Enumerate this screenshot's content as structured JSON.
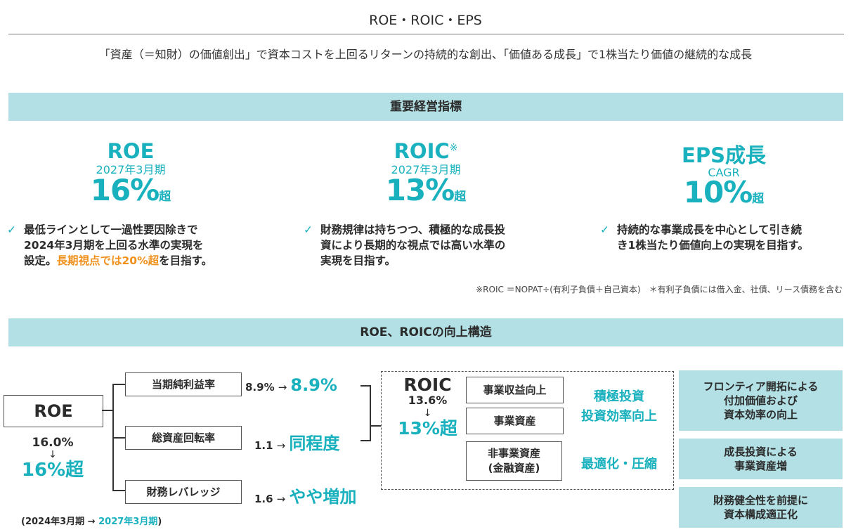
{
  "header": {
    "title": "ROE・ROIC・EPS",
    "subtitle": "「資産（＝知財）の価値創出」で資本コストを上回るリターンの持続的な創出、「価値ある成長」で1株当たり価値の継続的な成長"
  },
  "kpi_section": {
    "title": "重要経営指標",
    "items": [
      {
        "name": "ROE",
        "period": "2027年3月期",
        "value": "16%",
        "suffix": "超",
        "desc_lines": [
          "最低ラインとして一過性要因除きで",
          "2024年3月期を上回る水準の実現を"
        ],
        "desc_last_prefix": "設定。",
        "desc_highlight": "長期視点では20%超",
        "desc_last_suffix": "を目指す。"
      },
      {
        "name": "ROIC",
        "name_mark": "※",
        "period": "2027年3月期",
        "value": "13%",
        "suffix": "超",
        "desc_lines": [
          "財務規律は持ちつつ、積極的な成長投",
          "資により長期的な視点では高い水準の",
          "実現を目指す。"
        ]
      },
      {
        "name": "EPS成長",
        "period": "CAGR",
        "value": "10%",
        "suffix": "超",
        "desc_lines": [
          "持続的な事業成長を中心として引き続",
          "き1株当たり価値向上の実現を目指す。"
        ]
      }
    ],
    "footnote": "※ROIC ＝NOPAT÷(有利子負債＋自己資本)　＊有利子負債には借入金、社債、リース債務を含む"
  },
  "structure_section": {
    "title": "ROE、ROICの向上構造",
    "roe": {
      "label": "ROE",
      "from": "16.0%",
      "arrow": "↓",
      "to": "16%超"
    },
    "factors": [
      {
        "label": "当期純利益率",
        "current": "8.9%",
        "arrow": "→",
        "target": "8.9%"
      },
      {
        "label": "総資産回転率",
        "current": "1.1",
        "arrow": "→",
        "target": "同程度"
      },
      {
        "label": "財務レバレッジ",
        "current": "1.6",
        "arrow": "→",
        "target": "やや増加"
      }
    ],
    "period_note_prefix": "(2024年3月期 → ",
    "period_note_highlight": "2027年3月期",
    "period_note_suffix": ")",
    "roic": {
      "label": "ROIC",
      "from": "13.6%",
      "arrow": "↓",
      "to": "13%超"
    },
    "roic_boxes": [
      "事業収益向上",
      "事業資産",
      "非事業資産",
      "(金融資産)"
    ],
    "roic_actions": [
      "積極投資",
      "投資効率向上",
      "最適化・圧縮"
    ],
    "side_boxes": [
      [
        "フロンティア開拓による",
        "付加価値および",
        "資本効率の向上"
      ],
      [
        "成長投資による",
        "事業資産増"
      ],
      [
        "財務健全性を前提に",
        "資本構成適正化"
      ]
    ]
  }
}
